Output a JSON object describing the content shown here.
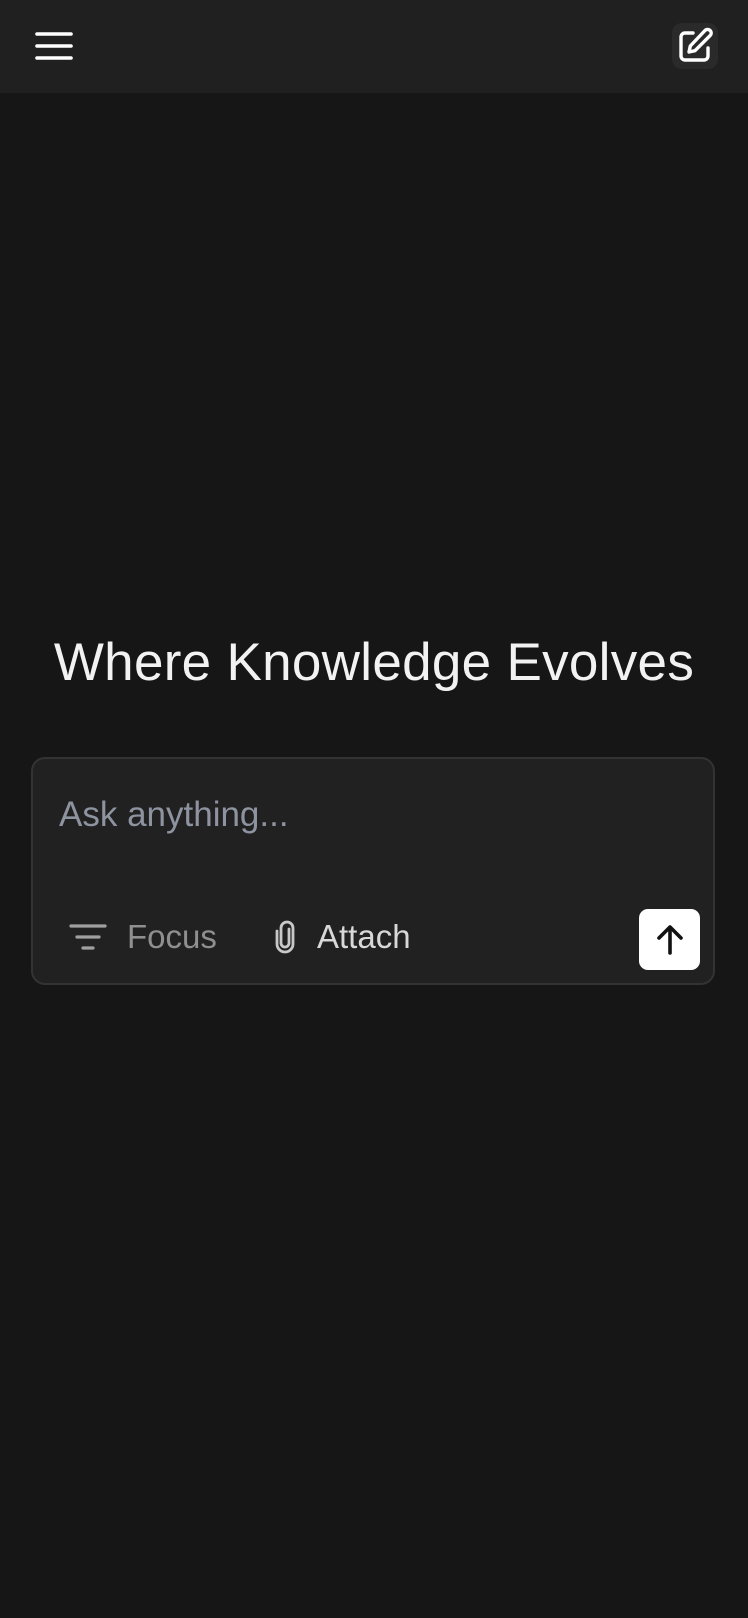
{
  "header": {
    "menu_icon": "hamburger-menu-icon",
    "new_thread_icon": "edit-square-icon"
  },
  "main": {
    "headline": "Where Knowledge Evolves"
  },
  "composer": {
    "placeholder": "Ask anything...",
    "value": "",
    "focus_label": "Focus",
    "focus_icon": "filter-lines-icon",
    "attach_label": "Attach",
    "attach_icon": "paperclip-icon",
    "send_icon": "arrow-up-icon"
  },
  "colors": {
    "background": "#161616",
    "header": "#202020",
    "composer_bg": "#212121",
    "composer_border": "#333333",
    "send_button": "#ffffff"
  }
}
